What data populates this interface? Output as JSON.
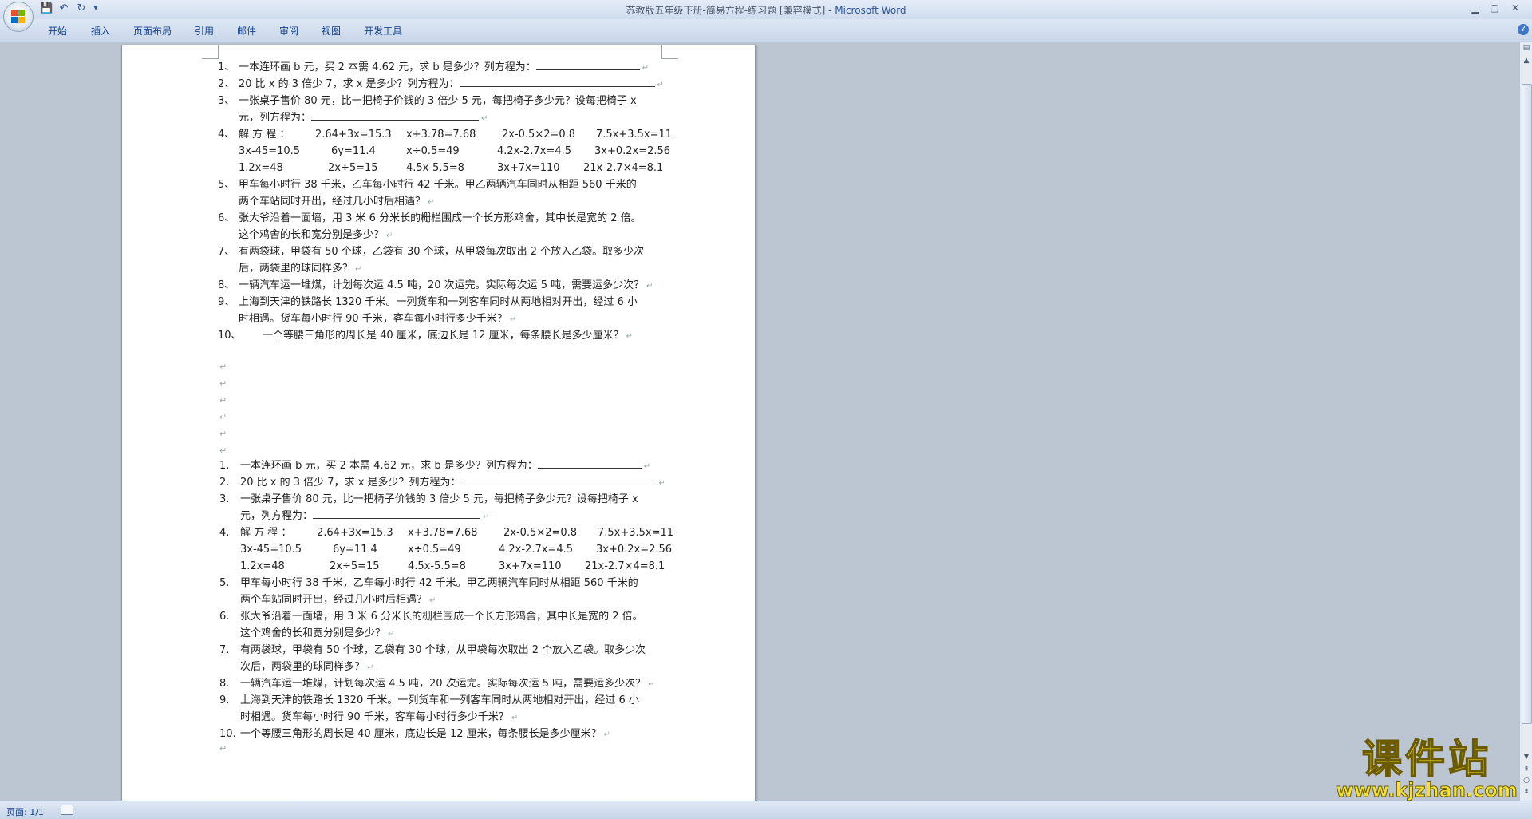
{
  "window": {
    "title_doc": "苏教版五年级下册-简易方程-练习题 [兼容模式] - ",
    "title_app": "Microsoft Word"
  },
  "qat": [
    {
      "icon": "save-icon",
      "glyph": "💾"
    },
    {
      "icon": "undo-icon",
      "glyph": "↶"
    },
    {
      "icon": "redo-icon",
      "glyph": "↻"
    },
    {
      "icon": "customize-icon",
      "glyph": "▾"
    }
  ],
  "ribbon": {
    "tabs": [
      "开始",
      "插入",
      "页面布局",
      "引用",
      "邮件",
      "审阅",
      "视图",
      "开发工具"
    ],
    "help": "?"
  },
  "doc": {
    "section1": {
      "q1": {
        "num": "1、",
        "text": "一本连环画 b 元，买 2 本需 4.62 元，求 b 是多少？列方程为："
      },
      "q2": {
        "num": "2、",
        "text": "20 比 x 的 3 倍少 7，求 x 是多少？列方程为："
      },
      "q3": {
        "num": "3、",
        "text": "一张桌子售价 80 元，比一把椅子价钱的 3 倍少 5 元，每把椅子多少元？设每把椅子 x",
        "cont": "元，列方程为："
      },
      "q4": {
        "num": "4、",
        "label": "解 方 程 ：",
        "rows": [
          [
            "2.64+3x=15.3",
            "x+3.78=7.68",
            "2x-0.5×2=0.8",
            "7.5x+3.5x=11"
          ],
          [
            "3x-45=10.5",
            "6y=11.4",
            "x÷0.5=49",
            "4.2x-2.7x=4.5",
            "3x+0.2x=2.56"
          ],
          [
            "1.2x=48",
            "2x÷5=15",
            "4.5x-5.5=8",
            "3x+7x=110",
            "21x-2.7×4=8.1"
          ]
        ]
      },
      "q5": {
        "num": "5、",
        "text": "甲车每小时行 38 千米，乙车每小时行 42 千米。甲乙两辆汽车同时从相距 560 千米的",
        "cont": "两个车站同时开出，经过几小时后相遇？"
      },
      "q6": {
        "num": "6、",
        "text": "张大爷沿着一面墙，用 3 米 6 分米长的栅栏围成一个长方形鸡舍，其中长是宽的 2 倍。",
        "cont": "这个鸡舍的长和宽分别是多少？"
      },
      "q7": {
        "num": "7、",
        "text": "有两袋球，甲袋有 50 个球，乙袋有 30 个球，从甲袋每次取出 2 个放入乙袋。取多少次",
        "cont": "后，两袋里的球同样多？"
      },
      "q8": {
        "num": "8、",
        "text": "一辆汽车运一堆煤，计划每次运 4.5 吨，20 次运完。实际每次运 5 吨，需要运多少次？"
      },
      "q9": {
        "num": "9、",
        "text": "上海到天津的铁路长 1320 千米。一列货车和一列客车同时从两地相对开出，经过 6 小",
        "cont": "时相遇。货车每小时行 90 千米，客车每小时行多少千米？"
      },
      "q10": {
        "num": "10、",
        "text": "一个等腰三角形的周长是 40 厘米，底边长是 12 厘米，每条腰长是多少厘米？"
      }
    },
    "section2": {
      "q1": {
        "num": "1.",
        "text": "一本连环画 b 元，买 2 本需 4.62 元，求 b 是多少？列方程为："
      },
      "q2": {
        "num": "2.",
        "text": "20 比 x 的 3 倍少 7，求 x 是多少？列方程为："
      },
      "q3": {
        "num": "3.",
        "text": "一张桌子售价 80 元，比一把椅子价钱的 3 倍少 5 元，每把椅子多少元？设每把椅子 x",
        "cont": "元，列方程为："
      },
      "q4": {
        "num": "4.",
        "label": "解 方 程 ：",
        "rows": [
          [
            "2.64+3x=15.3",
            "x+3.78=7.68",
            "2x-0.5×2=0.8",
            "7.5x+3.5x=11"
          ],
          [
            "3x-45=10.5",
            "6y=11.4",
            "x÷0.5=49",
            "4.2x-2.7x=4.5",
            "3x+0.2x=2.56"
          ],
          [
            "1.2x=48",
            "2x÷5=15",
            "4.5x-5.5=8",
            "3x+7x=110",
            "21x-2.7×4=8.1"
          ]
        ]
      },
      "q5": {
        "num": "5.",
        "text": "甲车每小时行 38 千米，乙车每小时行 42 千米。甲乙两辆汽车同时从相距 560 千米的",
        "cont": "两个车站同时开出，经过几小时后相遇？"
      },
      "q6": {
        "num": "6.",
        "text": "张大爷沿着一面墙，用 3 米 6 分米长的栅栏围成一个长方形鸡舍，其中长是宽的 2 倍。",
        "cont": "这个鸡舍的长和宽分别是多少？"
      },
      "q7": {
        "num": "7.",
        "text": "有两袋球，甲袋有 50 个球，乙袋有 30 个球，从甲袋每次取出 2 个放入乙袋。取多少次",
        "cont": "次后，两袋里的球同样多？"
      },
      "q8": {
        "num": "8.",
        "text": "一辆汽车运一堆煤，计划每次运 4.5 吨，20 次运完。实际每次运 5 吨，需要运多少次？"
      },
      "q9": {
        "num": "9.",
        "text": "上海到天津的铁路长 1320 千米。一列货车和一列客车同时从两地相对开出，经过 6 小",
        "cont": "时相遇。货车每小时行 90 千米，客车每小时行多少千米？"
      },
      "q10": {
        "num": "10.",
        "text": "一个等腰三角形的周长是 40 厘米，底边长是 12 厘米，每条腰长是多少厘米？"
      }
    },
    "para_mark": "↵"
  },
  "statusbar": {
    "page": "页面: 1/1"
  },
  "watermark": {
    "cn": "课件站",
    "url": "www.kjzhan.com"
  },
  "colors": {
    "accent": "#2b579a",
    "workspace": "#bcc6d3"
  }
}
